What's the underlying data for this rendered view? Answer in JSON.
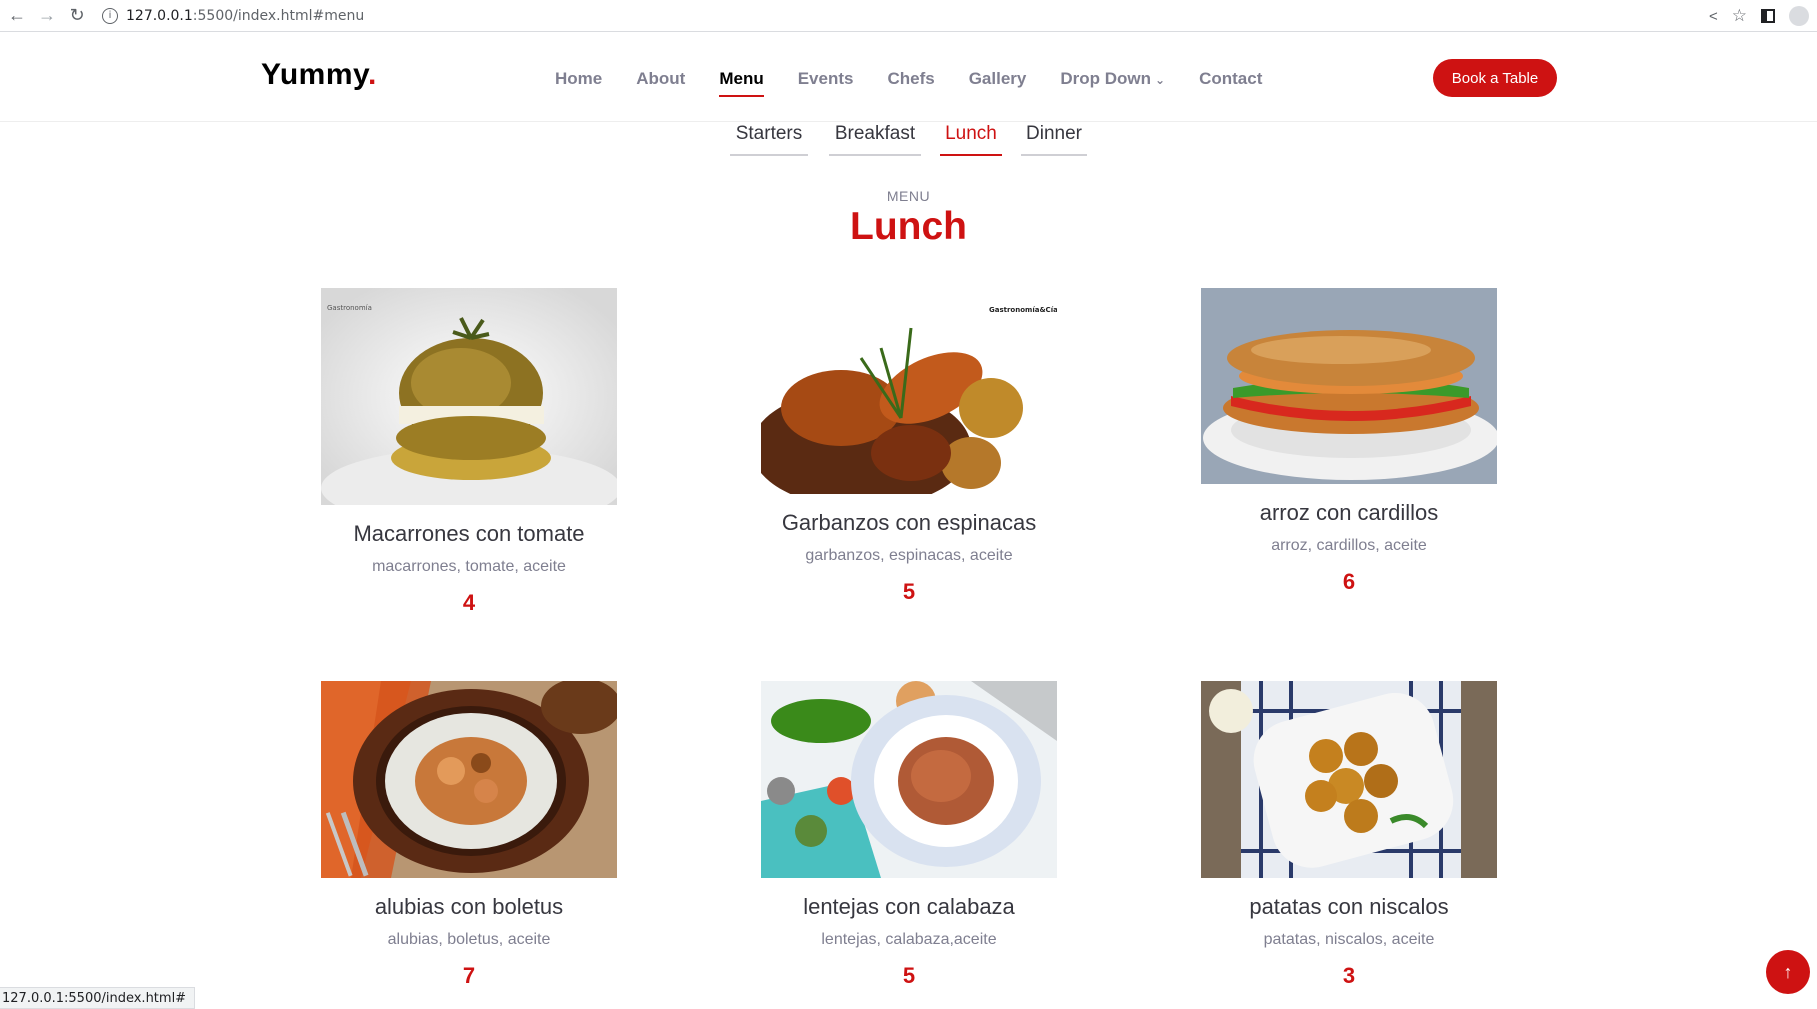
{
  "browser": {
    "url_host": "127.0.0.1",
    "url_rest": ":5500/index.html#menu",
    "status_url": "127.0.0.1:5500/index.html#"
  },
  "site": {
    "logo": "Yummy",
    "logo_dot": ".",
    "nav": [
      "Home",
      "About",
      "Menu",
      "Events",
      "Chefs",
      "Gallery",
      "Drop Down",
      "Contact"
    ],
    "active_nav": "Menu",
    "book_button": "Book a Table"
  },
  "tabs": [
    "Starters",
    "Breakfast",
    "Lunch",
    "Dinner"
  ],
  "active_tab": "Lunch",
  "section": {
    "subtitle": "MENU",
    "title": "Lunch"
  },
  "items": [
    {
      "name": "Macarrones con tomate",
      "ingredients": "macarrones, tomate, aceite",
      "price": "4",
      "image_icon": "stuffed-tomato-photo"
    },
    {
      "name": "Garbanzos con espinacas",
      "ingredients": "garbanzos, espinacas, aceite",
      "price": "5",
      "image_icon": "meat-stew-photo"
    },
    {
      "name": "arroz con cardillos",
      "ingredients": "arroz, cardillos, aceite",
      "price": "6",
      "image_icon": "sandwich-photo"
    },
    {
      "name": "alubias con boletus",
      "ingredients": "alubias, boletus, aceite",
      "price": "7",
      "image_icon": "shrimp-plate-photo"
    },
    {
      "name": "lentejas con calabaza",
      "ingredients": "lentejas, calabaza,aceite",
      "price": "5",
      "image_icon": "rice-dish-photo"
    },
    {
      "name": "patatas con niscalos",
      "ingredients": "patatas, niscalos, aceite",
      "price": "3",
      "image_icon": "croquettes-photo"
    }
  ],
  "colors": {
    "accent": "#ce1212",
    "text_dark": "#37373f",
    "text_muted": "#7f7f90"
  }
}
